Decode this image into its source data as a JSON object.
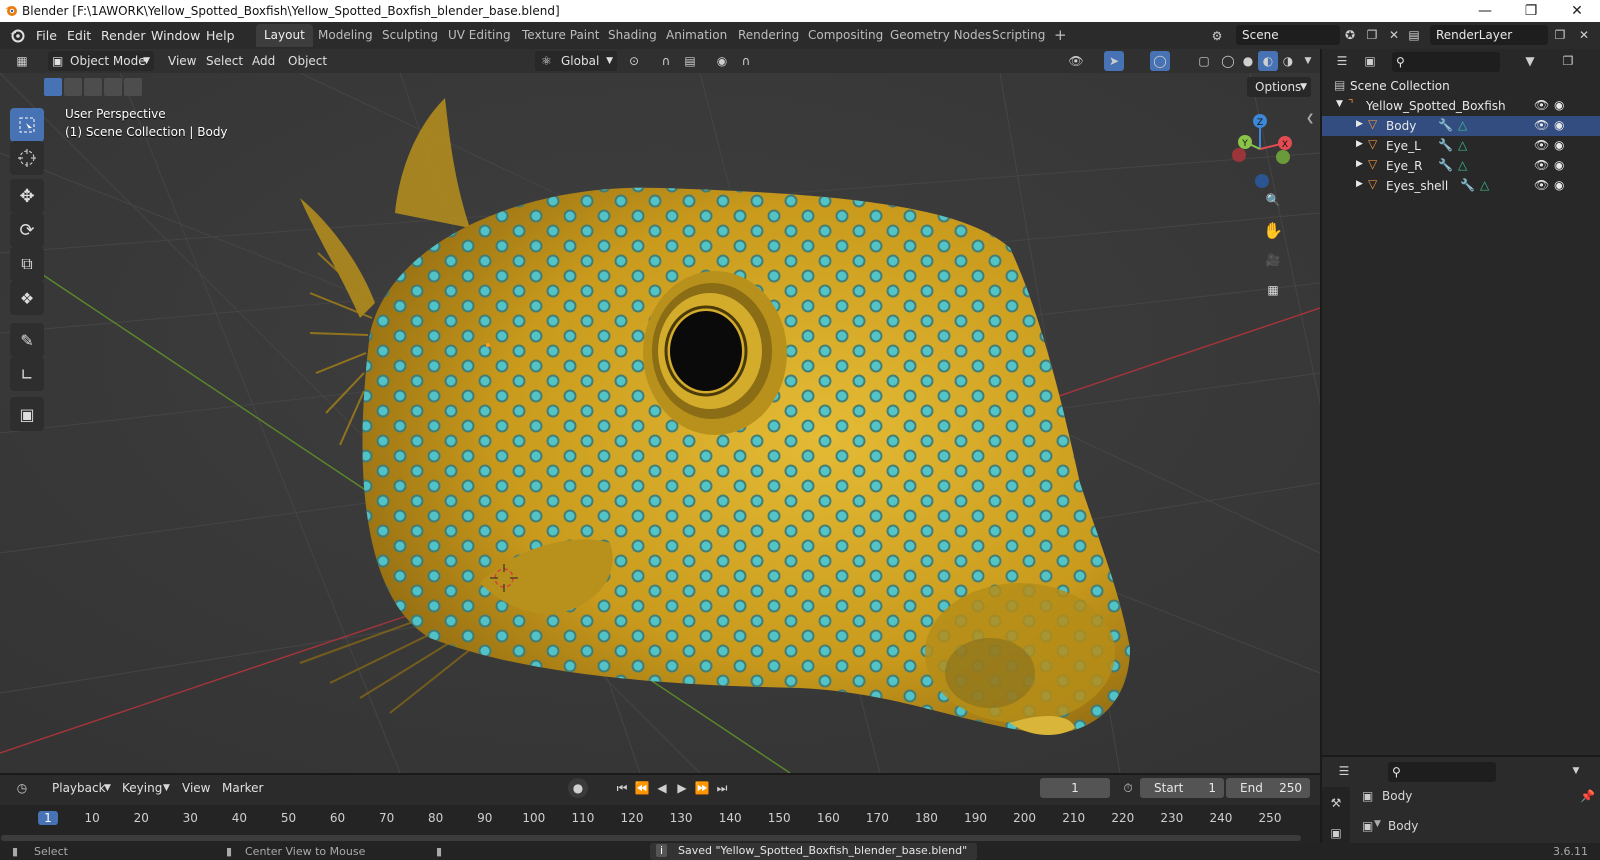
{
  "window": {
    "title": "Blender [F:\\1AWORK\\Yellow_Spotted_Boxfish\\Yellow_Spotted_Boxfish_blender_base.blend]"
  },
  "menu": [
    "File",
    "Edit",
    "Render",
    "Window",
    "Help"
  ],
  "workspaces": [
    "Layout",
    "Modeling",
    "Sculpting",
    "UV Editing",
    "Texture Paint",
    "Shading",
    "Animation",
    "Rendering",
    "Compositing",
    "Geometry Nodes",
    "Scripting"
  ],
  "active_workspace": "Layout",
  "scene": {
    "name": "Scene",
    "render_layer": "RenderLayer"
  },
  "viewport_header": {
    "mode": "Object Mode",
    "menus": [
      "View",
      "Select",
      "Add",
      "Object"
    ],
    "transform_orientation": "Global",
    "options_label": "Options"
  },
  "viewport": {
    "perspective_label": "User Perspective",
    "collection_label": "(1) Scene Collection | Body",
    "gizmo_axes": {
      "x": "X",
      "y": "Y",
      "z": "Z"
    }
  },
  "colors": {
    "accent": "#4772b3",
    "axis_x": "#e34b52",
    "axis_y": "#8bc34a",
    "axis_z": "#3d87d8",
    "fish_body": "#d4a820",
    "fish_spot": "#4cc6d1"
  },
  "outliner": {
    "root": "Scene Collection",
    "collection": "Yellow_Spotted_Boxfish",
    "objects": [
      "Body",
      "Eye_L",
      "Eye_R",
      "Eyes_shell"
    ]
  },
  "properties": {
    "object_name": "Body",
    "data_name": "Body"
  },
  "timeline": {
    "menus": [
      "Playback",
      "Keying",
      "View",
      "Marker"
    ],
    "current_frame": "1",
    "start_label": "Start",
    "start_value": "1",
    "end_label": "End",
    "end_value": "250",
    "ruler": [
      "1",
      "10",
      "20",
      "30",
      "40",
      "50",
      "60",
      "70",
      "80",
      "90",
      "100",
      "110",
      "120",
      "130",
      "140",
      "150",
      "160",
      "170",
      "180",
      "190",
      "200",
      "210",
      "220",
      "230",
      "240",
      "250"
    ]
  },
  "statusbar": {
    "left_action": "Select",
    "middle_action": "Center View to Mouse",
    "message": "Saved \"Yellow_Spotted_Boxfish_blender_base.blend\"",
    "version": "3.6.11"
  }
}
